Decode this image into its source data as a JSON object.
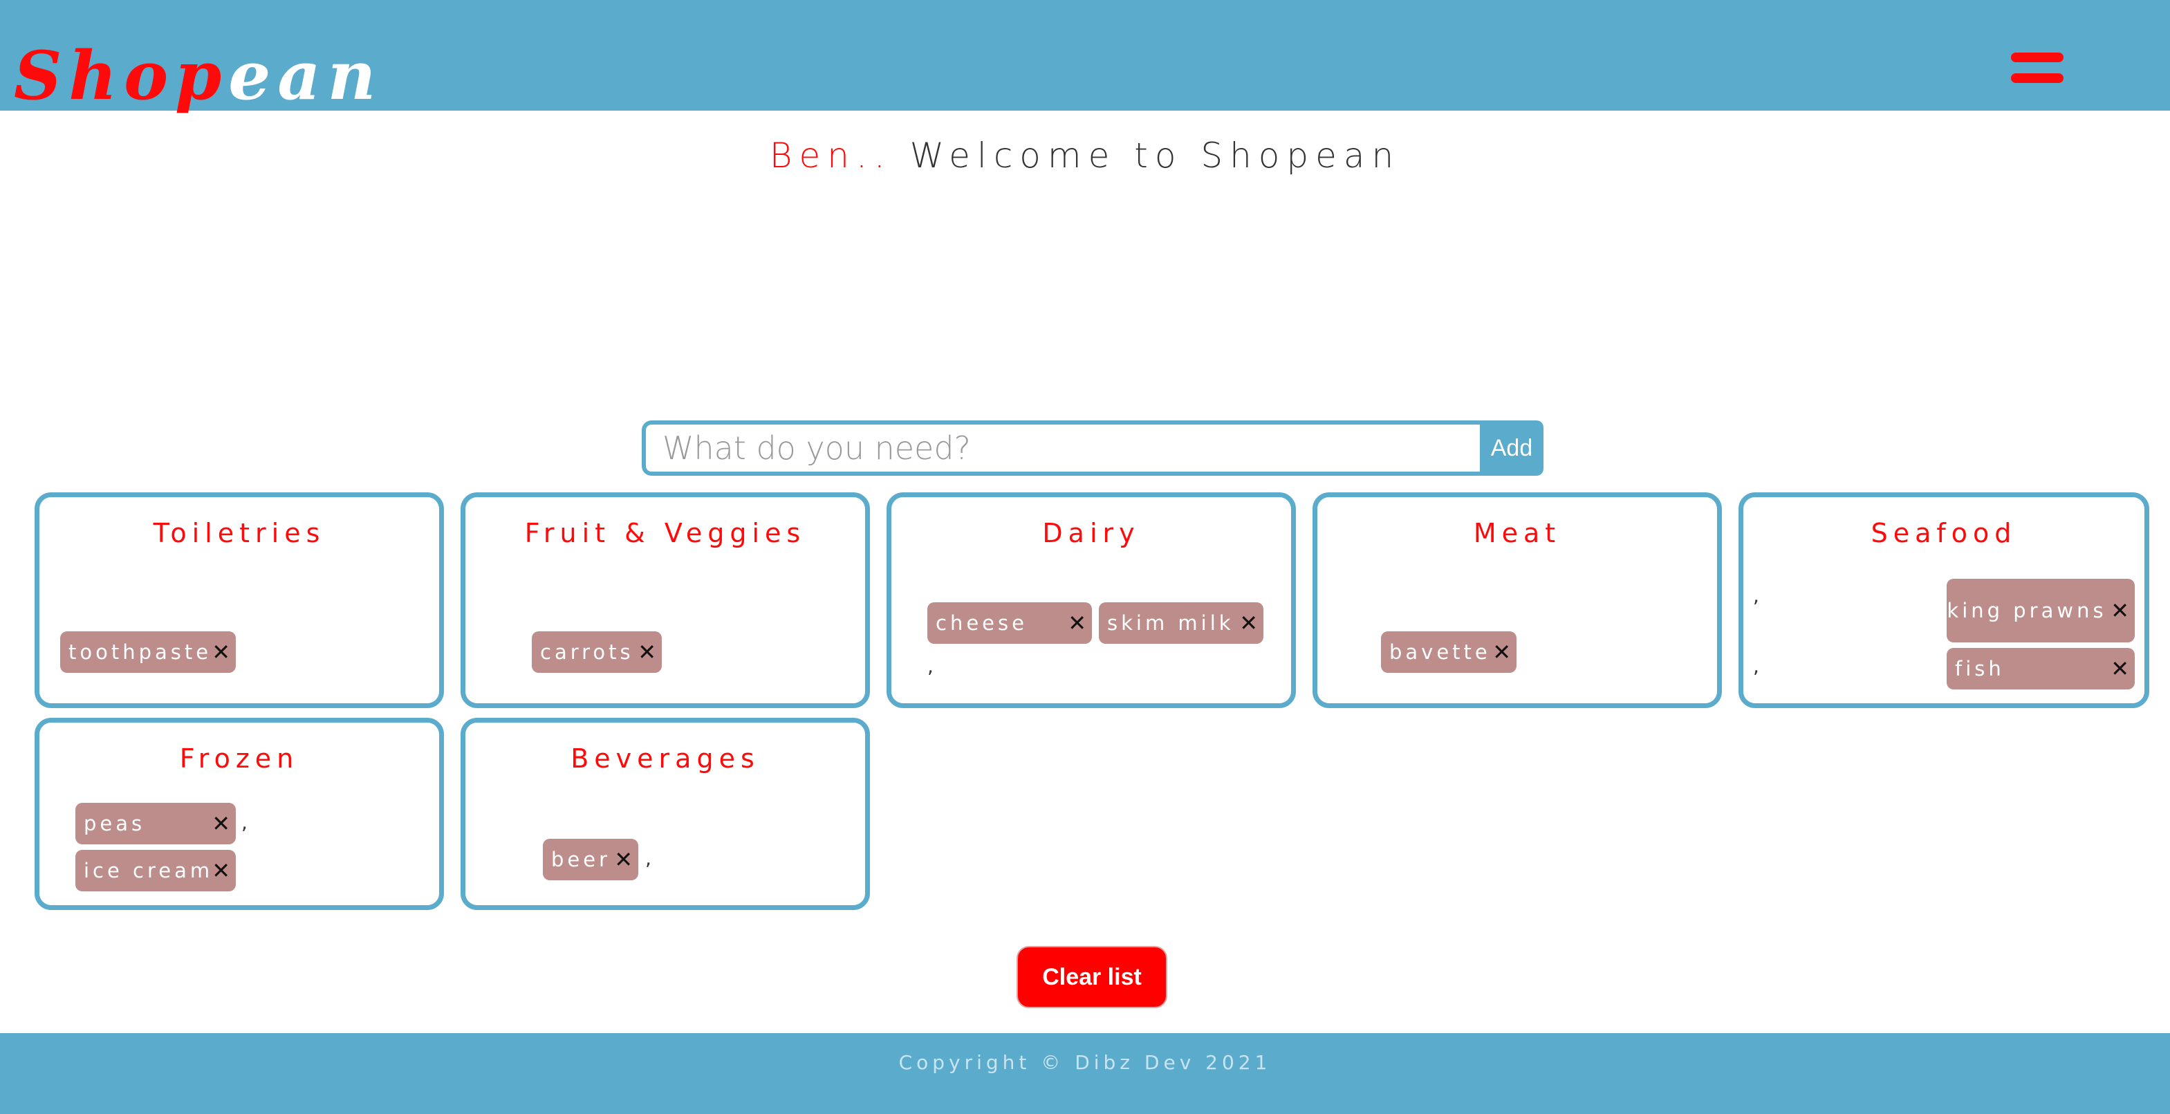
{
  "header": {
    "logo_part1": "Shop",
    "logo_part2": "ean",
    "menu_icon": "hamburger-icon"
  },
  "welcome": {
    "name": "Ben..",
    "message": " Welcome to Shopean"
  },
  "search": {
    "placeholder": "What do you need?",
    "value": "",
    "add_label": "Add"
  },
  "categories": {
    "toiletries": {
      "title": "Toiletries",
      "items": [
        "toothpaste"
      ]
    },
    "fruit_veggies": {
      "title": "Fruit & Veggies",
      "items": [
        "carrots"
      ]
    },
    "dairy": {
      "title": "Dairy",
      "items": [
        "cheese",
        "skim milk"
      ],
      "separator": ","
    },
    "meat": {
      "title": "Meat",
      "items": [
        "bavette"
      ]
    },
    "seafood": {
      "title": "Seafood",
      "items": [
        "king prawns",
        "fish"
      ],
      "separator": ","
    },
    "frozen": {
      "title": "Frozen",
      "items": [
        "peas",
        "ice cream"
      ],
      "separator": ","
    },
    "beverages": {
      "title": "Beverages",
      "items": [
        "beer"
      ],
      "separator": ","
    }
  },
  "remove_symbol": "✕",
  "clear_label": "Clear list",
  "footer": {
    "copyright": "Copyright © Dibz Dev 2021"
  },
  "colors": {
    "primary": "#5babcd",
    "accent": "#ff0a0a",
    "pill": "#bc8d8b"
  }
}
